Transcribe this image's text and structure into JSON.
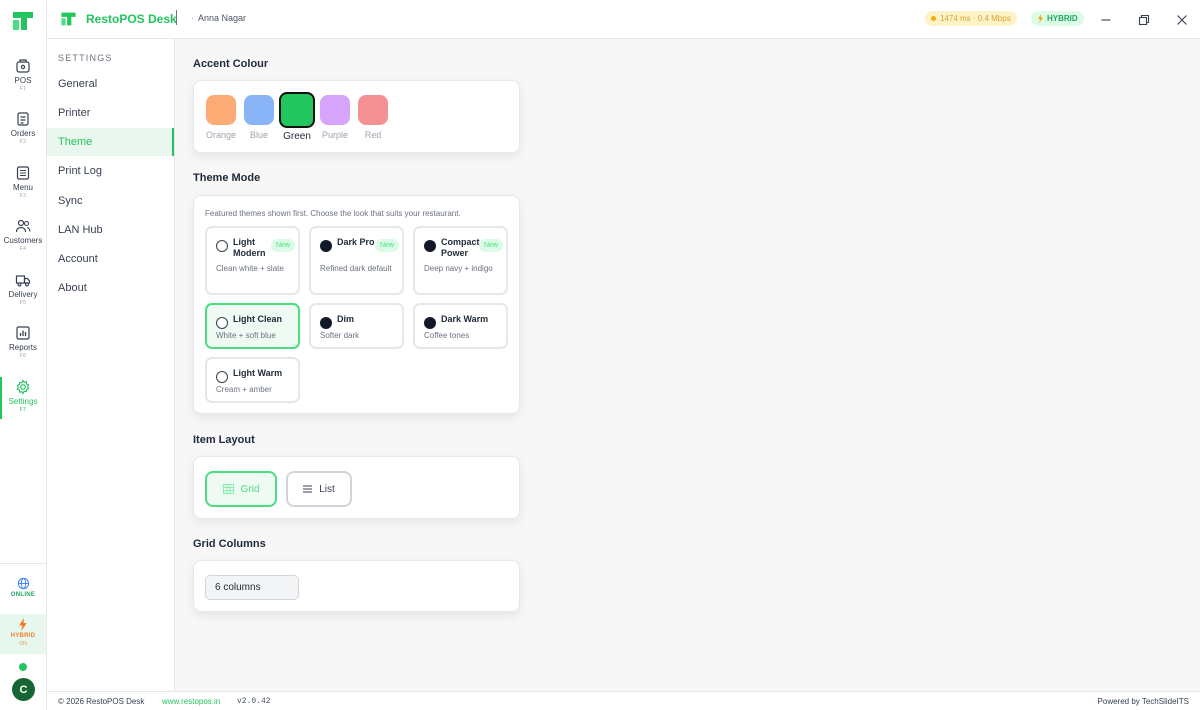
{
  "app": {
    "name": "RestoPOS Desk",
    "branch": "Anna Nagar"
  },
  "header": {
    "latency": "1474 ms · 0.4 Mbps",
    "mode": "HYBRID"
  },
  "rail": {
    "items": [
      {
        "label": "POS",
        "key": "F1",
        "icon": "pos-icon"
      },
      {
        "label": "Orders",
        "key": "F2",
        "icon": "orders-icon"
      },
      {
        "label": "Menu",
        "key": "F3",
        "icon": "menu-icon"
      },
      {
        "label": "Customers",
        "key": "F4",
        "icon": "customers-icon"
      },
      {
        "label": "Delivery",
        "key": "F5",
        "icon": "delivery-icon"
      },
      {
        "label": "Reports",
        "key": "F6",
        "icon": "reports-icon"
      },
      {
        "label": "Settings",
        "key": "F7",
        "icon": "settings-icon",
        "active": true
      }
    ],
    "online": "ONLINE",
    "hybrid": "HYBRID",
    "hybrid_sub": "ON",
    "avatar": "C"
  },
  "settings_nav": {
    "title": "SETTINGS",
    "items": [
      "General",
      "Printer",
      "Theme",
      "Print Log",
      "Sync",
      "LAN Hub",
      "Account",
      "About"
    ],
    "active": "Theme"
  },
  "accent": {
    "title": "Accent Colour",
    "colors": [
      {
        "name": "Orange",
        "hex": "#fdab74"
      },
      {
        "name": "Blue",
        "hex": "#8ab4f8"
      },
      {
        "name": "Green",
        "hex": "#22c55e",
        "selected": true
      },
      {
        "name": "Purple",
        "hex": "#d7a4fb"
      },
      {
        "name": "Red",
        "hex": "#f49293"
      }
    ]
  },
  "theme_mode": {
    "title": "Theme Mode",
    "hint": "Featured themes shown first. Choose the look that suits your restaurant.",
    "themes": [
      {
        "name": "Light Modern",
        "desc": "Clean white + slate",
        "badge": "New",
        "dark": false
      },
      {
        "name": "Dark Pro",
        "desc": "Refined dark default",
        "badge": "New",
        "dark": true
      },
      {
        "name": "Compact Power",
        "desc": "Deep navy + indigo",
        "badge": "New",
        "dark": true
      },
      {
        "name": "Light Clean",
        "desc": "White + soft blue",
        "badge": "",
        "dark": false,
        "selected": true
      },
      {
        "name": "Dim",
        "desc": "Softer dark",
        "badge": "",
        "dark": true
      },
      {
        "name": "Dark Warm",
        "desc": "Coffee tones",
        "badge": "",
        "dark": true
      },
      {
        "name": "Light Warm",
        "desc": "Cream + amber",
        "badge": "",
        "dark": false
      }
    ]
  },
  "item_layout": {
    "title": "Item Layout",
    "options": [
      "Grid",
      "List"
    ],
    "selected": "Grid"
  },
  "grid_columns": {
    "title": "Grid Columns",
    "value": "6 columns"
  },
  "footer": {
    "copyright": "© 2026 RestoPOS Desk",
    "link": "www.restopos.in",
    "version": "v2.0.42",
    "powered": "Powered by TechSlideITS"
  }
}
